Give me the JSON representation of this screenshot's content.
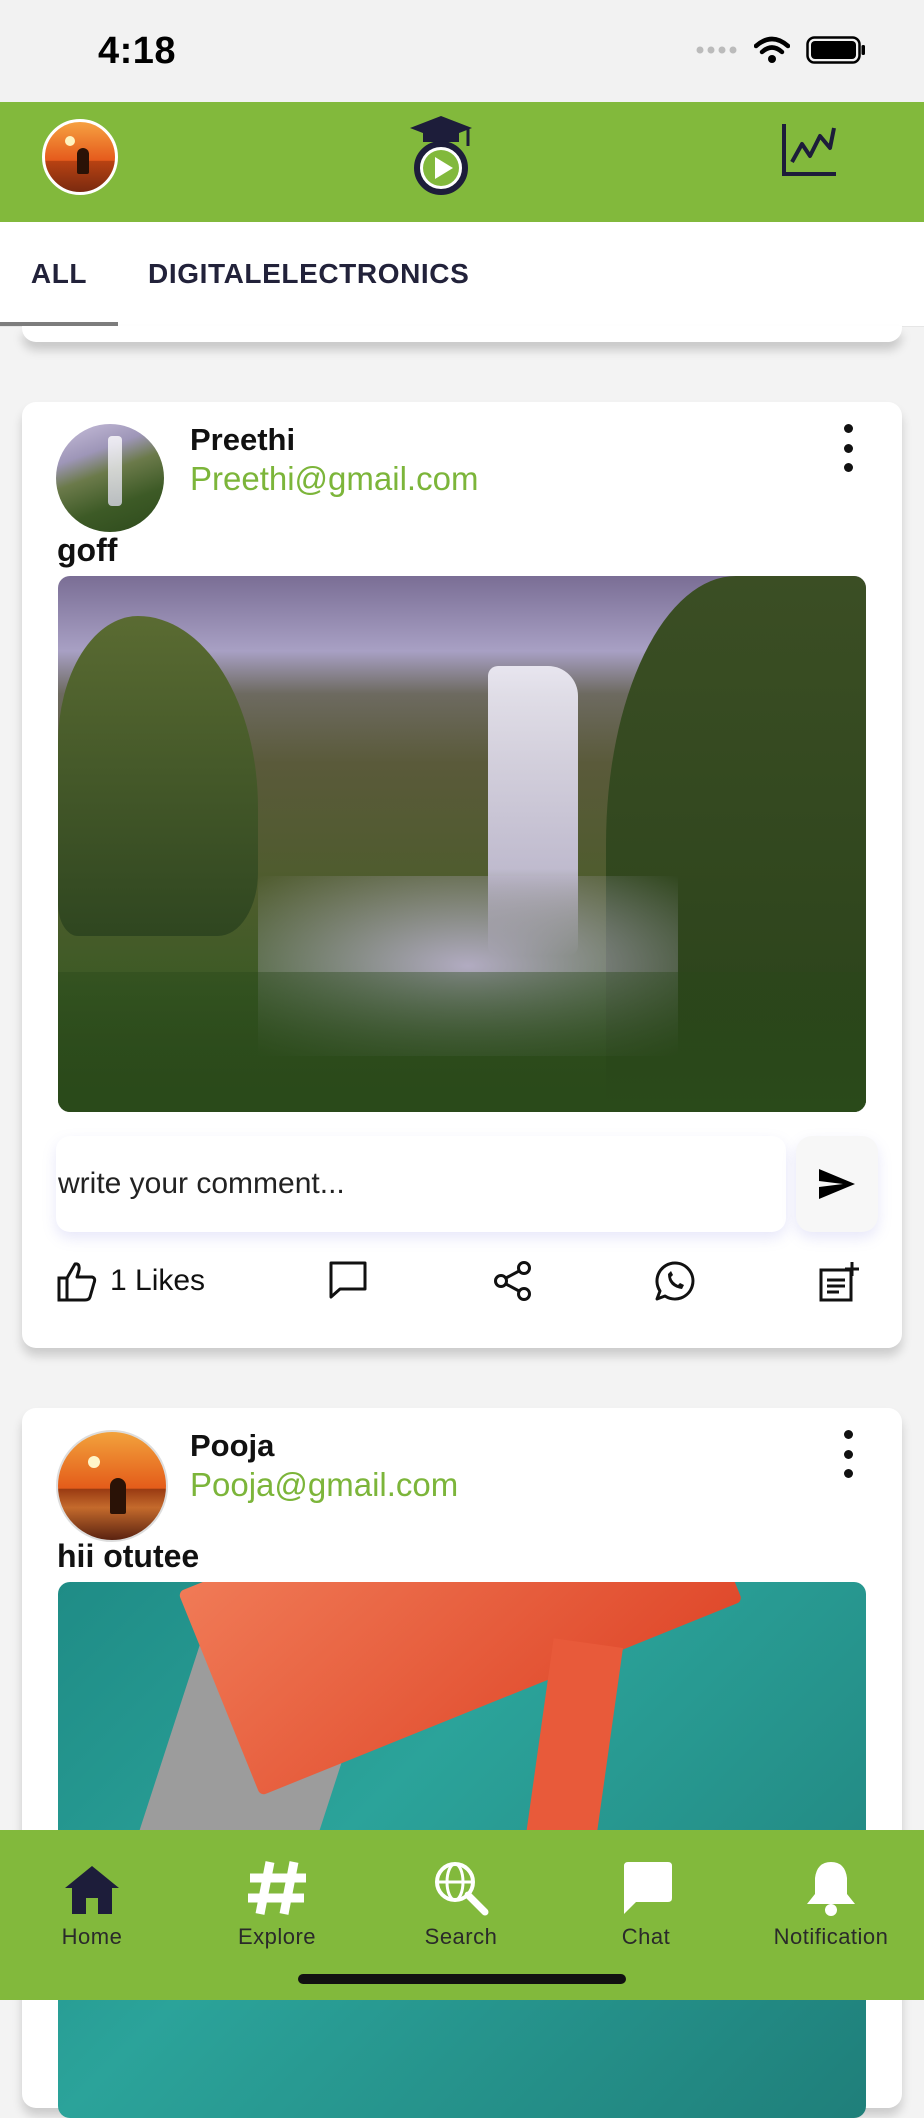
{
  "status_bar": {
    "time": "4:18"
  },
  "header": {
    "avatar_icon": "user-avatar",
    "logo_icon": "graduation-play-logo",
    "chart_icon": "line-chart-icon",
    "accent_color": "#82b93c"
  },
  "tabs": [
    {
      "label": "ALL",
      "active": true
    },
    {
      "label": "DIGITALELECTRONICS",
      "active": false
    }
  ],
  "posts": [
    {
      "name": "Preethi",
      "email": "Preethi@gmail.com",
      "caption": "goff",
      "comment_placeholder": "write your comment...",
      "likes": "1 Likes"
    },
    {
      "name": "Pooja",
      "email": "Pooja@gmail.com",
      "caption": "hii otutee"
    }
  ],
  "bottom_nav": [
    {
      "label": "Home",
      "icon": "home-icon"
    },
    {
      "label": "Explore",
      "icon": "hashtag-icon"
    },
    {
      "label": "Search",
      "icon": "globe-search-icon"
    },
    {
      "label": "Chat",
      "icon": "chat-bubble-icon"
    },
    {
      "label": "Notification",
      "icon": "bell-icon"
    }
  ]
}
